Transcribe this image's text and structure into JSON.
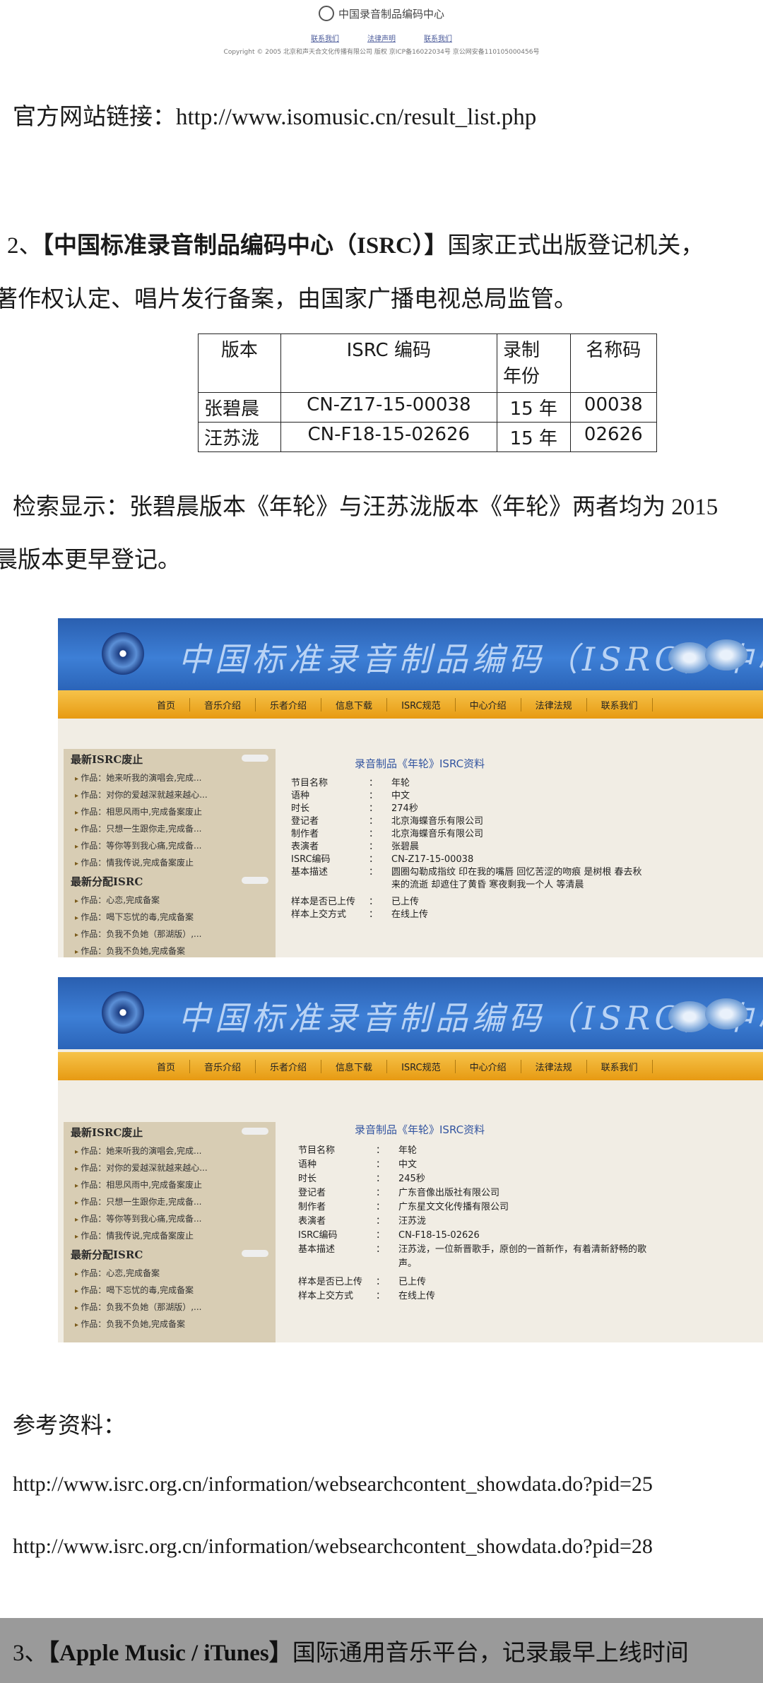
{
  "top_footer": {
    "logo_text": "中国录音制品编码中心",
    "links": [
      "联系我们",
      "法律声明",
      "联系我们"
    ],
    "copyright": "Copyright © 2005 北京和声天合文化传播有限公司 版权 京ICP备16022034号 京公网安备110105000456号"
  },
  "official_site": "官方网站链接：http://www.isomusic.cn/result_list.php",
  "section2": {
    "line1_prefix": "2、",
    "line1_bold": "【中国标准录音制品编码中心（ISRC）】",
    "line1_rest": "国家正式出版登记机关，",
    "line2": "著作权认定、唱片发行备案，由国家广播电视总局监管。"
  },
  "isrc_table": {
    "headers": [
      "版本",
      "ISRC 编码",
      "录制\n年份",
      "名称码"
    ],
    "rows": [
      [
        "张碧晨",
        "CN-Z17-15-00038",
        "15 年",
        "00038"
      ],
      [
        "汪苏泷",
        "CN-F18-15-02626",
        "15 年",
        "02626"
      ]
    ]
  },
  "search_result": {
    "line1": "检索显示：张碧晨版本《年轮》与汪苏泷版本《年轮》两者均为 2015",
    "line2": "晨版本更早登记。"
  },
  "site": {
    "banner_title": "中国标准录音制品编码（ISRC）中心",
    "nav": [
      "首页",
      "音乐介绍",
      "乐者介绍",
      "信息下载",
      "ISRC规范",
      "中心介绍",
      "法律法规",
      "联系我们"
    ],
    "sidebar_head1": "最新ISRC废止",
    "sidebar_items1": [
      "作品：她来听我的演唱会,完成...",
      "作品：对你的爱越深就越来越心...",
      "作品：相思风雨中,完成备案废止",
      "作品：只想一生跟你走,完成备...",
      "作品：等你等到我心痛,完成备...",
      "作品：情我传说,完成备案废止"
    ],
    "sidebar_head2": "最新分配ISRC",
    "sidebar_items2": [
      "作品：心恋,完成备案",
      "作品：喝下忘忧的毒,完成备案",
      "作品：负我不负她（那湖版）,...",
      "作品：负我不负她,完成备案"
    ],
    "info_title": "录音制品《年轮》ISRC资料",
    "field_labels": [
      "节目名称",
      "语种",
      "时长",
      "登记者",
      "制作者",
      "表演者",
      "ISRC编码",
      "基本描述",
      "样本是否已上传",
      "样本上交方式"
    ]
  },
  "record1": {
    "values": [
      "年轮",
      "中文",
      "274秒",
      "北京海蝶音乐有限公司",
      "北京海蝶音乐有限公司",
      "张碧晨",
      "CN-Z17-15-00038",
      "圆圈勾勒成指纹 印在我的嘴唇 回忆苦涩的吻痕 是树根 春去秋",
      "已上传",
      "在线上传"
    ],
    "desc_line2": "来的流逝 却遮住了黄昏 寒夜剩我一个人 等清晨"
  },
  "record2": {
    "values": [
      "年轮",
      "中文",
      "245秒",
      "广东音像出版社有限公司",
      "广东星文文化传播有限公司",
      "汪苏泷",
      "CN-F18-15-02626",
      "汪苏泷，一位新晋歌手，原创的一首新作，有着清新舒畅的歌",
      "已上传",
      "在线上传"
    ],
    "desc_line2": "声。"
  },
  "references": {
    "label": "参考资料：",
    "url1": "http://www.isrc.org.cn/information/websearchcontent_showdata.do?pid=25",
    "url2": "http://www.isrc.org.cn/information/websearchcontent_showdata.do?pid=28"
  },
  "section3": {
    "prefix": "3、",
    "bold": "【Apple Music / iTunes】",
    "rest": "国际通用音乐平台，记录最早上线时间"
  }
}
